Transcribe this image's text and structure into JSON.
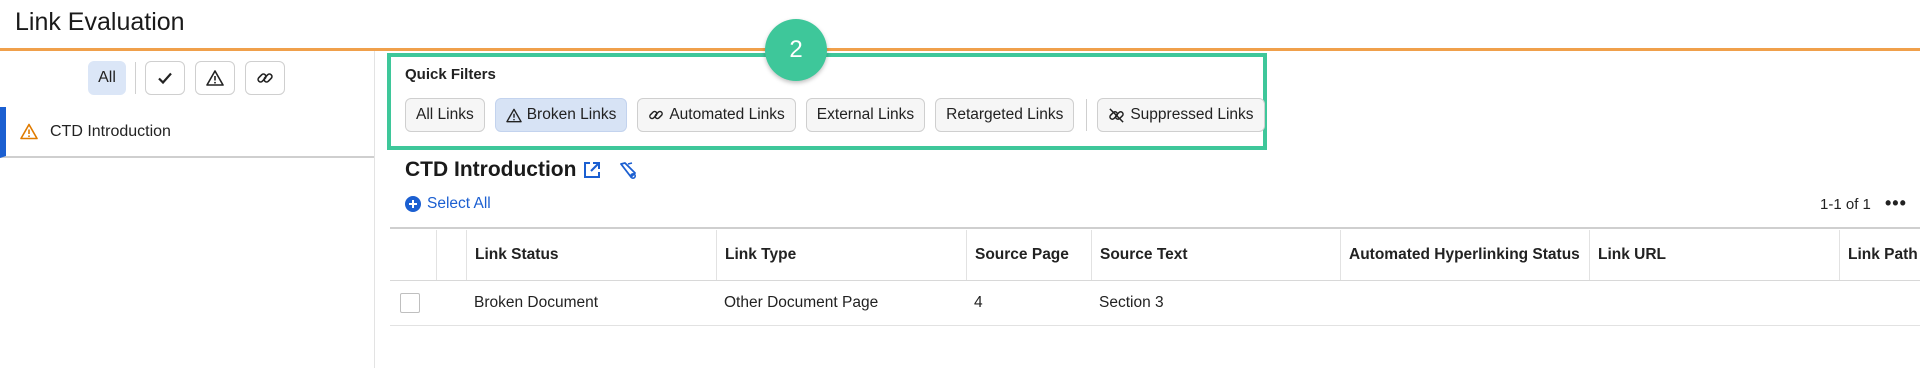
{
  "app": {
    "title": "Link Evaluation"
  },
  "left_pane": {
    "filters": {
      "all_label": "All"
    },
    "documents": [
      {
        "label": "CTD Introduction"
      }
    ]
  },
  "quick_filters": {
    "label": "Quick Filters",
    "items": [
      {
        "label": "All Links",
        "icon": ""
      },
      {
        "label": "Broken Links",
        "icon": "warning-icon",
        "active": true
      },
      {
        "label": "Automated Links",
        "icon": "link-icon"
      },
      {
        "label": "External Links",
        "icon": ""
      },
      {
        "label": "Retargeted Links",
        "icon": ""
      },
      {
        "label": "Suppressed Links",
        "icon": "link-off-icon"
      }
    ]
  },
  "step_badge": "2",
  "section": {
    "title": "CTD Introduction",
    "select_all": "Select All",
    "pager": "1-1 of 1"
  },
  "table": {
    "columns": [
      "Link Status",
      "Link Type",
      "Source Page",
      "Source Text",
      "Automated Hyperlinking Status",
      "Link URL",
      "Link Path"
    ],
    "rows": [
      {
        "link_status": "Broken Document",
        "link_type": "Other Document Page",
        "source_page": "4",
        "source_text": "Section 3",
        "automated_status": "",
        "link_url": "",
        "link_path": ""
      }
    ]
  },
  "colors": {
    "accent_orange": "#f0a04b",
    "highlight_green": "#3ec79a",
    "link_blue": "#1b5fd1",
    "warning_orange": "#e07b00"
  }
}
